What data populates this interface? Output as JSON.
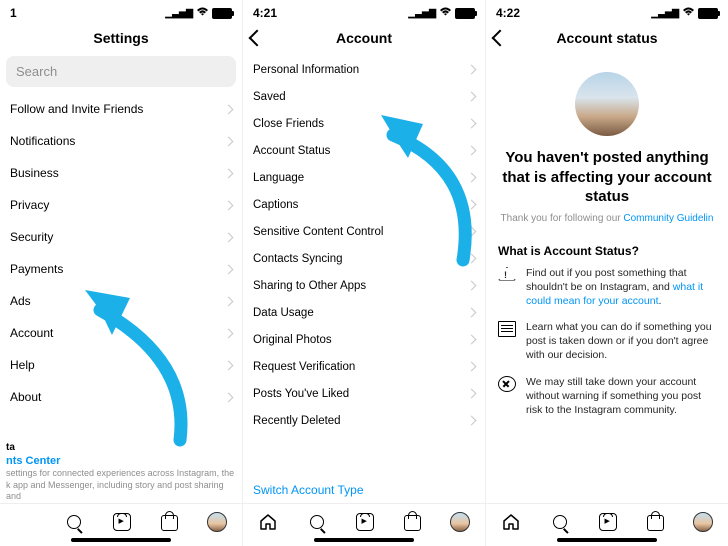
{
  "screen1": {
    "time": "1",
    "title": "Settings",
    "search_placeholder": "Search",
    "items": [
      "Follow and Invite Friends",
      "Notifications",
      "Business",
      "Privacy",
      "Security",
      "Payments",
      "Ads",
      "Account",
      "Help",
      "About"
    ],
    "meta_label": "ta",
    "meta_link": "nts Center",
    "meta_desc": "settings for connected experiences across Instagram, the k app and Messenger, including story and post sharing and"
  },
  "screen2": {
    "time": "4:21",
    "title": "Account",
    "items": [
      "Personal Information",
      "Saved",
      "Close Friends",
      "Account Status",
      "Language",
      "Captions",
      "Sensitive Content Control",
      "Contacts Syncing",
      "Sharing to Other Apps",
      "Data Usage",
      "Original Photos",
      "Request Verification",
      "Posts You've Liked",
      "Recently Deleted"
    ],
    "switch_label": "Switch Account Type"
  },
  "screen3": {
    "time": "4:22",
    "title": "Account status",
    "headline": "You haven't posted anything that is affecting your account status",
    "sub_prefix": "Thank you for following our ",
    "sub_link": "Community Guidelin",
    "section_heading": "What is Account Status?",
    "rows": [
      {
        "text_a": "Find out if you post something that shouldn't be on Instagram, and ",
        "link": "what it could mean for your account",
        "text_b": "."
      },
      {
        "text_a": "Learn what you can do if something you post is taken down or if you don't agree with our decision.",
        "link": "",
        "text_b": ""
      },
      {
        "text_a": "We may still take down your account without warning if something you post risk to the Instagram community.",
        "link": "",
        "text_b": ""
      }
    ]
  }
}
